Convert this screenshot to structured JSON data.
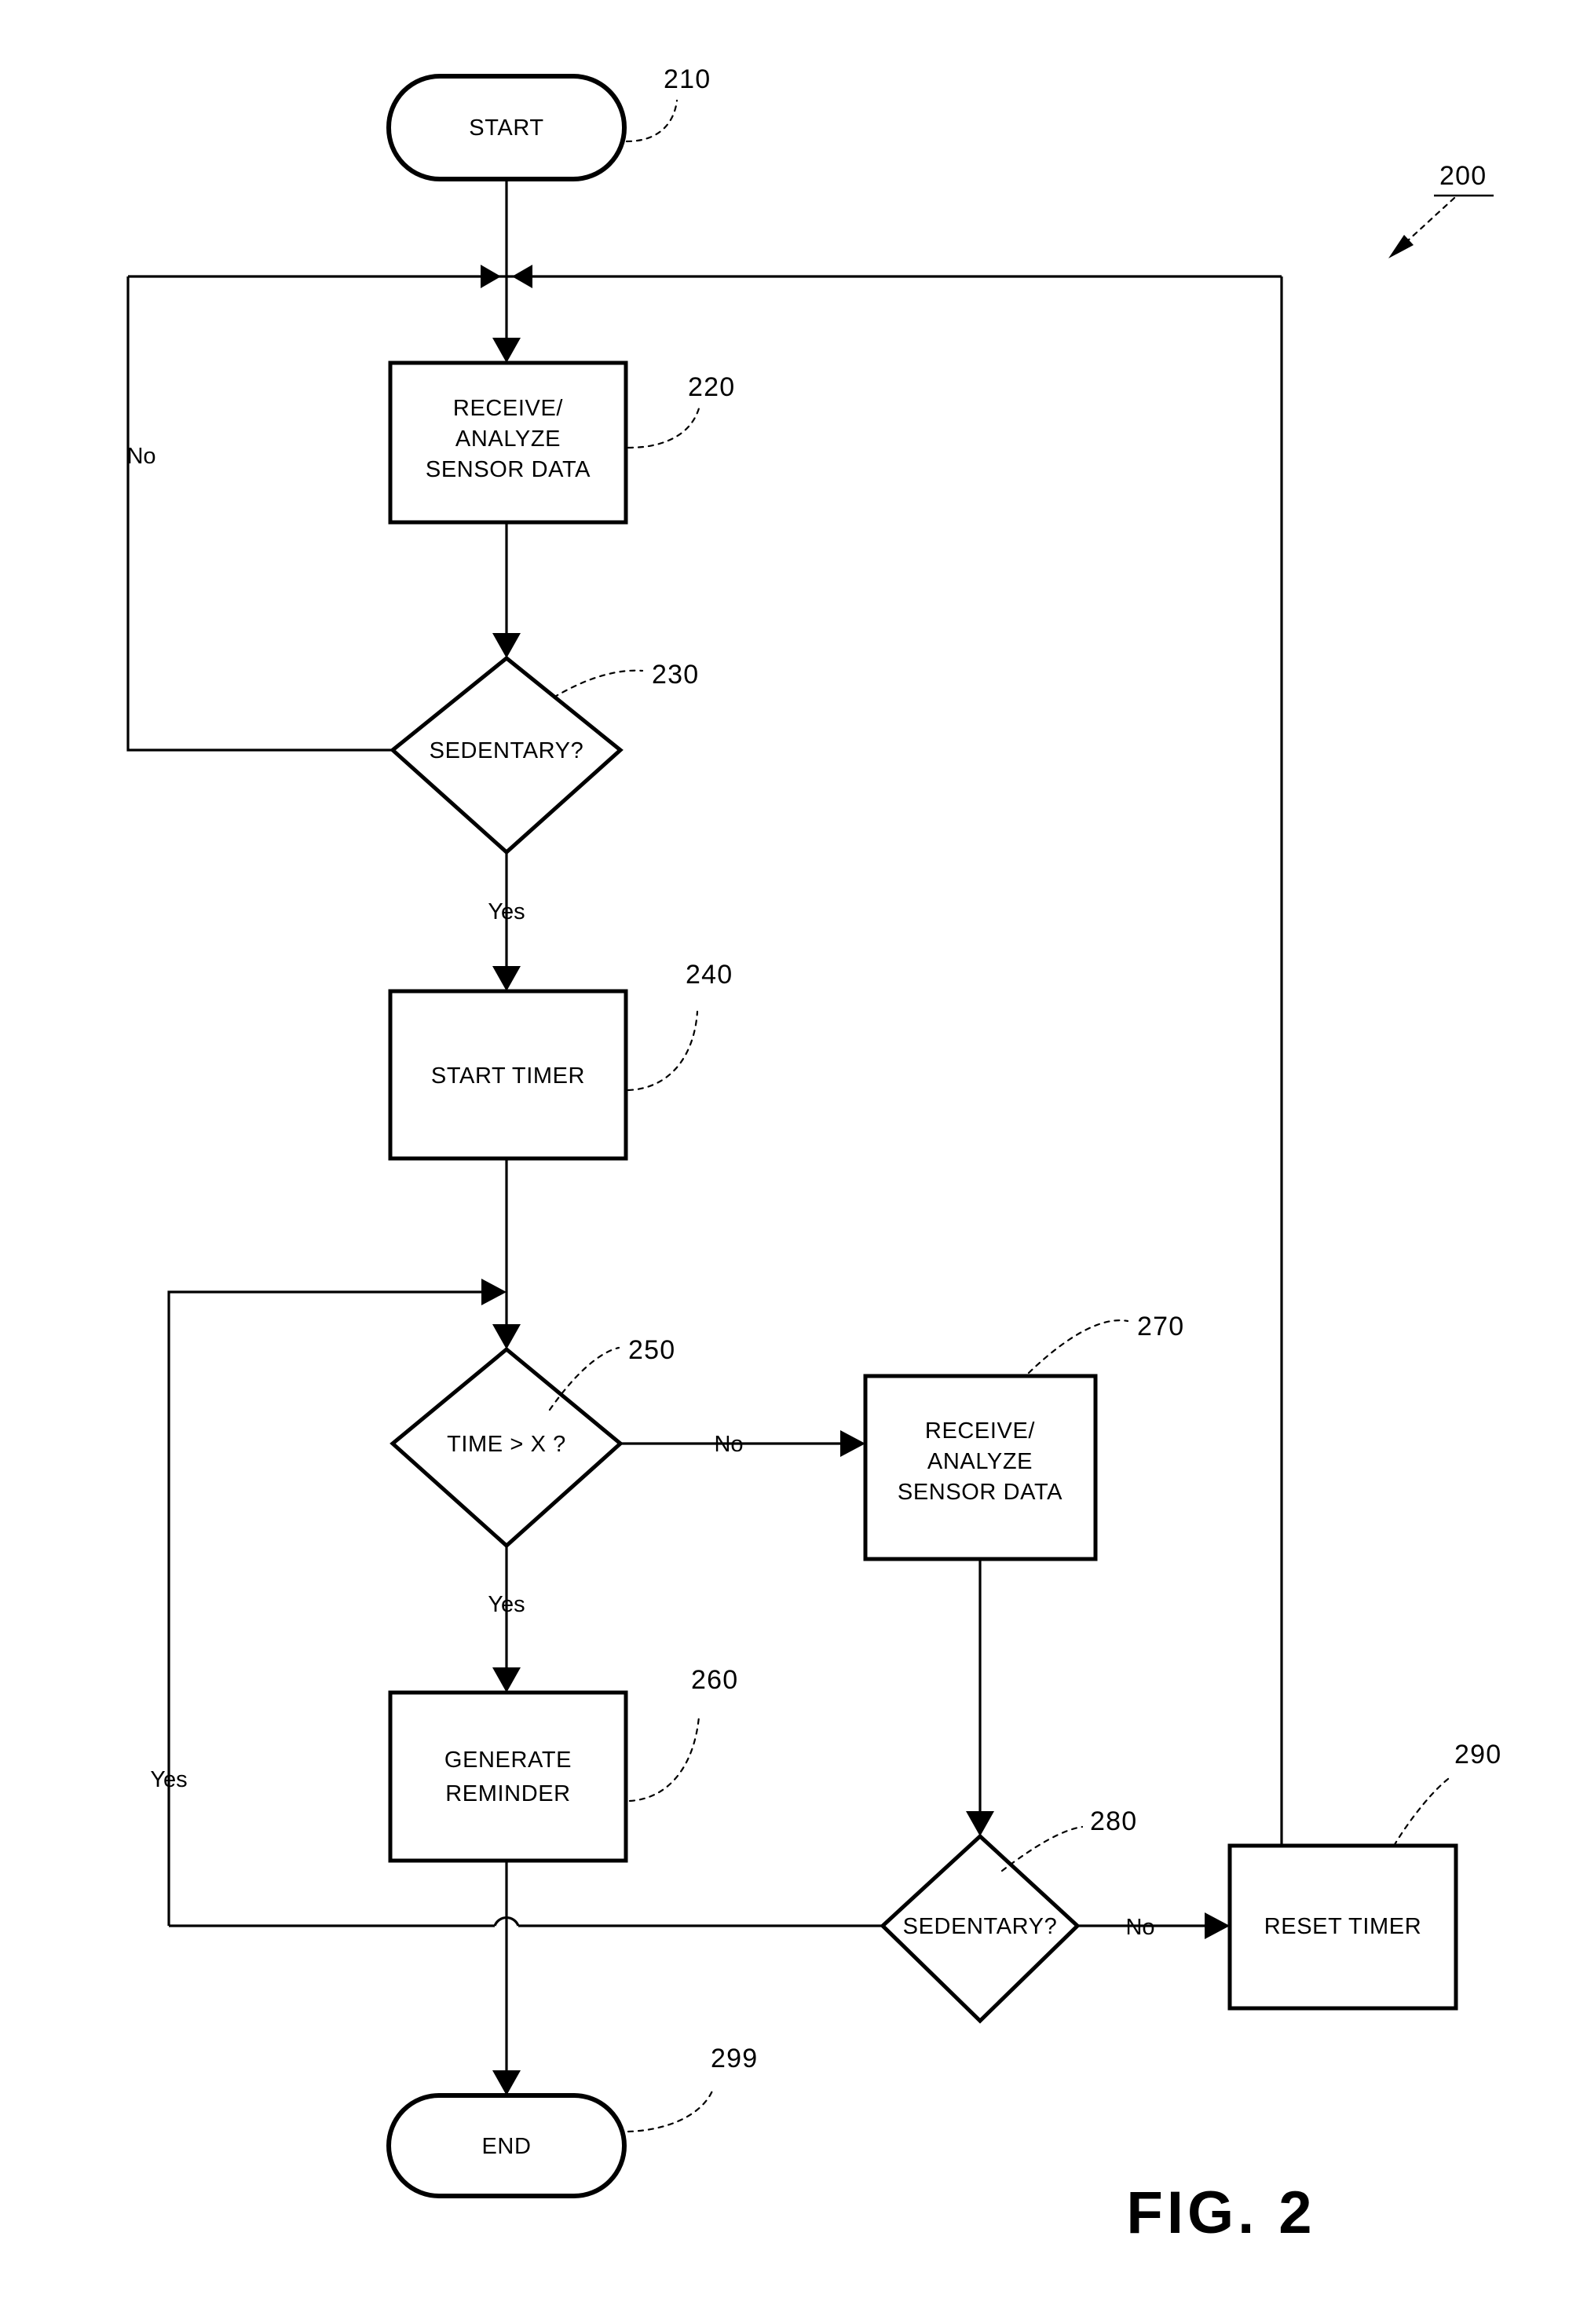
{
  "figure": {
    "caption": "FIG. 2",
    "diagram_ref": "200"
  },
  "nodes": {
    "start": {
      "id": "210",
      "label": "START",
      "shape": "terminal"
    },
    "receive_analyze_1": {
      "id": "220",
      "label_line1": "RECEIVE/",
      "label_line2": "ANALYZE",
      "label_line3": "SENSOR DATA",
      "shape": "process"
    },
    "sedentary_1": {
      "id": "230",
      "label": "SEDENTARY?",
      "shape": "decision"
    },
    "start_timer": {
      "id": "240",
      "label": "START TIMER",
      "shape": "process"
    },
    "time_gt_x": {
      "id": "250",
      "label": "TIME > X ?",
      "shape": "decision"
    },
    "generate_reminder": {
      "id": "260",
      "label_line1": "GENERATE",
      "label_line2": "REMINDER",
      "shape": "process"
    },
    "receive_analyze_2": {
      "id": "270",
      "label_line1": "RECEIVE/",
      "label_line2": "ANALYZE",
      "label_line3": "SENSOR DATA",
      "shape": "process"
    },
    "sedentary_2": {
      "id": "280",
      "label": "SEDENTARY?",
      "shape": "decision"
    },
    "reset_timer": {
      "id": "290",
      "label": "RESET TIMER",
      "shape": "process"
    },
    "end": {
      "id": "299",
      "label": "END",
      "shape": "terminal"
    }
  },
  "branch_labels": {
    "sedentary_1_no": "No",
    "sedentary_1_yes": "Yes",
    "time_gt_x_no": "No",
    "time_gt_x_yes": "Yes",
    "sedentary_2_no": "No",
    "sedentary_2_yes": "Yes"
  },
  "colors": {
    "ink": "#000000",
    "paper": "#ffffff"
  }
}
